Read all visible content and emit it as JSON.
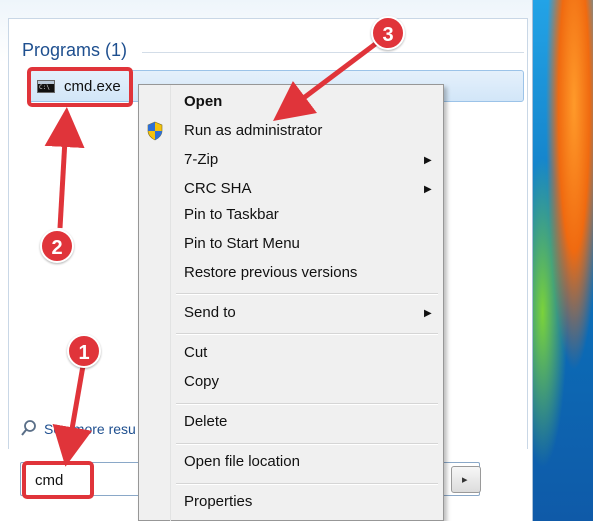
{
  "start_menu": {
    "programs_header": "Programs (1)",
    "program_item_label": "cmd.exe",
    "program_icon_text": "C:\\",
    "see_more_label": "See more resu",
    "search_value": "cmd",
    "go_button_glyph": "▸"
  },
  "context_menu": {
    "items": [
      {
        "label": "Open",
        "bold": true
      },
      {
        "label": "Run as administrator",
        "icon": "uac-shield-icon"
      },
      {
        "label": "7-Zip",
        "submenu": true
      },
      {
        "label": "CRC SHA",
        "submenu": true
      },
      {
        "label": "Pin to Taskbar"
      },
      {
        "label": "Pin to Start Menu"
      },
      {
        "label": "Restore previous versions"
      },
      {
        "label": "Send to",
        "submenu": true
      },
      {
        "label": "Cut"
      },
      {
        "label": "Copy"
      },
      {
        "label": "Delete"
      },
      {
        "label": "Open file location"
      },
      {
        "label": "Properties"
      }
    ],
    "submenu_glyph": "▶"
  },
  "annotations": {
    "step1": "1",
    "step2": "2",
    "step3": "3",
    "color": "#e0343a"
  }
}
